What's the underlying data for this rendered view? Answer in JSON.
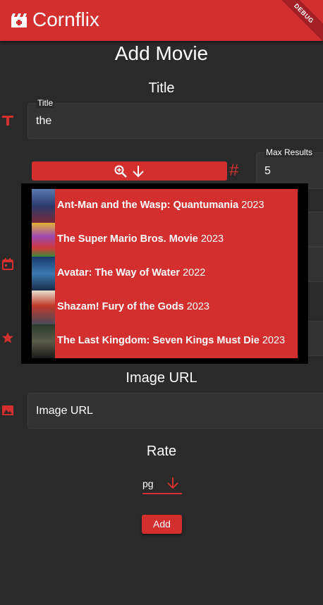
{
  "app": {
    "title": "Cornflix",
    "debug_label": "DEBUG"
  },
  "page": {
    "title": "Add Movie"
  },
  "title_section": {
    "heading": "Title",
    "field_label": "Title",
    "value": "the"
  },
  "max_results": {
    "label": "Max Results",
    "value": "5"
  },
  "search_results": [
    {
      "title": "Ant-Man and the Wasp: Quantumania",
      "year": "2023",
      "poster_color": "#3a4a7a"
    },
    {
      "title": "The Super Mario Bros. Movie",
      "year": "2023",
      "poster_color": "#7a4a9a"
    },
    {
      "title": "Avatar: The Way of Water",
      "year": "2022",
      "poster_color": "#2a4a7a"
    },
    {
      "title": "Shazam! Fury of the Gods",
      "year": "2023",
      "poster_color": "#b33a2a"
    },
    {
      "title": "The Last Kingdom: Seven Kings Must Die",
      "year": "2023",
      "poster_color": "#3a3a3a"
    }
  ],
  "image_section": {
    "heading": "Image URL",
    "placeholder": "Image URL"
  },
  "rate_section": {
    "heading": "Rate",
    "selected": "pg"
  },
  "add_button": {
    "label": "Add"
  },
  "colors": {
    "accent": "#d32f2f",
    "background": "#2a2a2a",
    "field": "#333333"
  }
}
